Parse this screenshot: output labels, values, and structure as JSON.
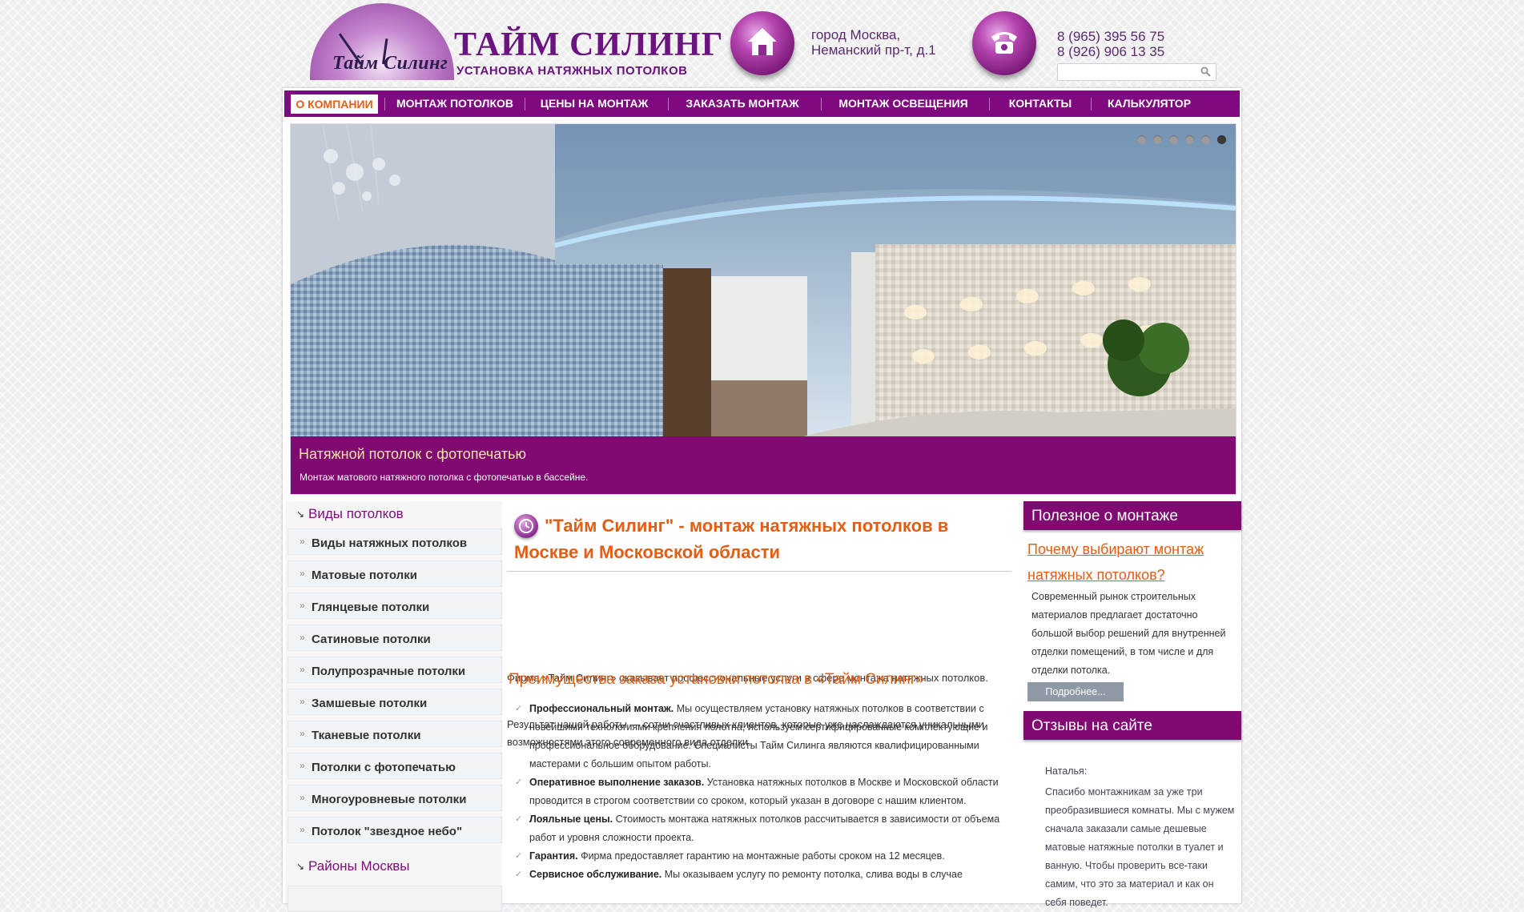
{
  "header": {
    "logo_text": "Тайм Силинг",
    "brand_title": "ТАЙМ СИЛИНГ",
    "brand_subtitle": "УСТАНОВКА НАТЯЖНЫХ ПОТОЛКОВ",
    "address_line1": "город Москва,",
    "address_line2": "Неманский пр-т, д.1",
    "phone1": "8 (965) 395 56 75",
    "phone2": "8 (926) 906 13 35",
    "search_placeholder": ""
  },
  "nav": {
    "items": [
      {
        "label": "О КОМПАНИИ"
      },
      {
        "label": "МОНТАЖ ПОТОЛКОВ"
      },
      {
        "label": "ЦЕНЫ НА МОНТАЖ"
      },
      {
        "label": "ЗАКАЗАТЬ МОНТАЖ"
      },
      {
        "label": "МОНТАЖ ОСВЕЩЕНИЯ"
      },
      {
        "label": "КОНТАКТЫ"
      },
      {
        "label": "КАЛЬКУЛЯТОР"
      }
    ],
    "active_index": 0
  },
  "slider": {
    "caption_title": "Натяжной потолок с фотопечатью",
    "caption_text": "Монтаж матового натяжного потолка с фотопечатью в бассейне.",
    "dot_count": 6,
    "active_dot": 5
  },
  "sidebar": {
    "heading": "Виды потолков",
    "items": [
      "Виды натяжных потолков",
      "Матовые потолки",
      "Глянцевые потолки",
      "Сатиновые потолки",
      "Полупрозрачные потолки",
      "Замшевые потолки",
      "Тканевые потолки",
      "Потолки с фотопечатью",
      "Многоуровневые потолки",
      "Потолок \"звездное небо\""
    ],
    "heading2": "Районы Москвы"
  },
  "article": {
    "title": "\"Тайм Силинг\" - монтаж натяжных потолков в Москве и Московской области",
    "p1": "Фирма «Тайм Силинг» оказывает профессиональные услуги в сфере монтажа натяжных потолков.",
    "p2": "Результат нашей работы — сотни счастливых клиентов, которые уже наслаждаются уникальными возможностями этого современного вида отделки.",
    "subheading": "Преимущества заказа установки потолка в «Тайм Силинг»",
    "benefits": [
      {
        "bold": "Профессиональный монтаж.",
        "text": " Мы осуществляем установку натяжных потолков в соответствии с новейшими технологиями крепления полотна, используем сертифицированные комплектующие и профессиональное оборудование. Специалисты Тайм Силинга являются квалифицированными мастерами с большим опытом работы."
      },
      {
        "bold": "Оперативное выполнение заказов.",
        "text": " Установка натяжных потолков в Москве и Московской области проводится в строгом соответствии со сроком, который указан в договоре с нашим клиентом."
      },
      {
        "bold": "Лояльные цены.",
        "text": " Стоимость монтажа натяжных потолков рассчитывается в зависимости от объема работ и уровня сложности проекта."
      },
      {
        "bold": "Гарантия.",
        "text": " Фирма предоставляет гарантию на монтажные работы сроком на 12 месяцев."
      },
      {
        "bold": "Сервисное обслуживание.",
        "text": " Мы оказываем услугу по ремонту потолка, слива воды в случае"
      }
    ]
  },
  "right": {
    "heading1": "Полезное о монтаже",
    "link": "Почему выбирают монтаж натяжных потолков?",
    "text": "Современный рынок строительных материалов предлагает достаточно большой выбор решений для внутренней отделки помещений, в том числе и для отделки потолка.",
    "more": "Подробнее...",
    "heading2": "Отзывы на сайте",
    "review_name": "Наталья:",
    "review_text": "Спасибо монтажникам за уже три преобразившиеся комнаты. Мы с мужем сначала заказали самые дешевые матовые натяжные потолки в туалет и ванную. Чтобы проверить все-таки самим, что это за материал и как он себя поведет."
  },
  "colors": {
    "brand_purple": "#7f0a7f",
    "accent_orange": "#e45d12",
    "caption_title": "#f5e6a8"
  }
}
